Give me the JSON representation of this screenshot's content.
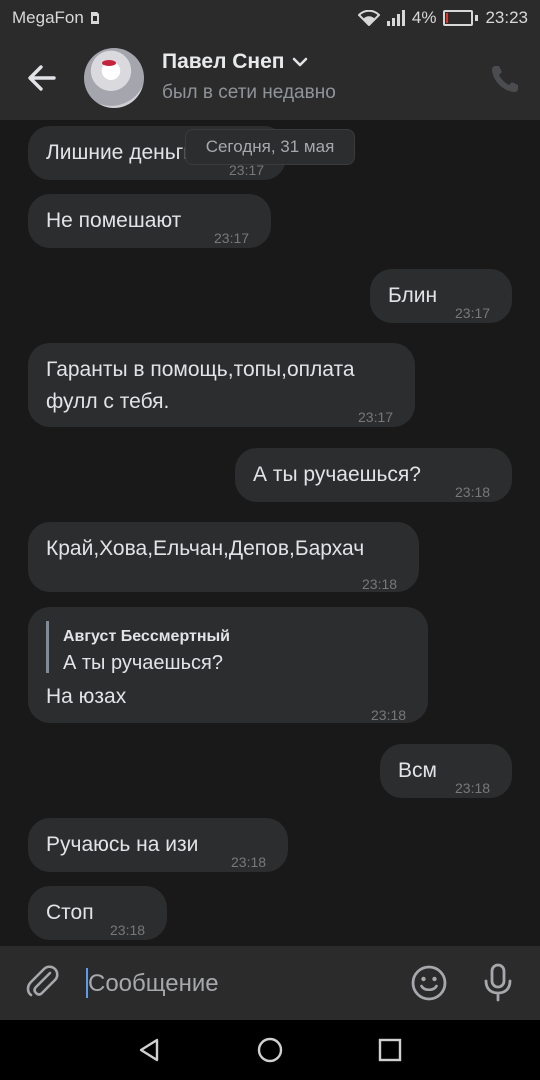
{
  "status_bar": {
    "carrier": "MegaFon",
    "battery_percent_text": "4%",
    "battery_level": 0.04,
    "time": "23:23"
  },
  "header": {
    "contact_name": "Павел Снеп",
    "contact_status": "был в сети недавно"
  },
  "chat": {
    "date_label": "Сегодня, 31 мая",
    "messages": [
      {
        "direction": "in",
        "text": "Лишние деньги",
        "time": "23:17"
      },
      {
        "direction": "in",
        "text": "Не помешают",
        "time": "23:17"
      },
      {
        "direction": "out",
        "text": "Блин",
        "time": "23:17"
      },
      {
        "direction": "in",
        "text_line1": "Гаранты в помощь,топы,оплата",
        "text_line2": "фулл с тебя.",
        "time": "23:17"
      },
      {
        "direction": "out",
        "text": "А ты ручаешься?",
        "time": "23:18"
      },
      {
        "direction": "in",
        "text": "Край,Хова,Ельчан,Депов,Бархач",
        "time": "23:18"
      },
      {
        "direction": "in",
        "reply_author": "Август Бессмертный",
        "reply_text": "А ты ручаешься?",
        "text": "На юзах",
        "time": "23:18"
      },
      {
        "direction": "out",
        "text": "Всм",
        "time": "23:18"
      },
      {
        "direction": "in",
        "text": "Ручаюсь на изи",
        "time": "23:18"
      },
      {
        "direction": "in",
        "text": "Стоп",
        "time": "23:18"
      }
    ]
  },
  "composer": {
    "placeholder": "Сообщение",
    "value": ""
  },
  "colors": {
    "background": "#19191a",
    "bubble": "#2c2d2e",
    "bar": "#2b2b2c",
    "accent": "#5d9cec",
    "battery_low": "#e0352b"
  },
  "icons": [
    "back-arrow-icon",
    "phone-icon",
    "paperclip-icon",
    "smile-icon",
    "microphone-icon",
    "wifi-icon",
    "signal-icon",
    "battery-icon",
    "nav-back-icon",
    "nav-home-icon",
    "nav-recents-icon"
  ]
}
